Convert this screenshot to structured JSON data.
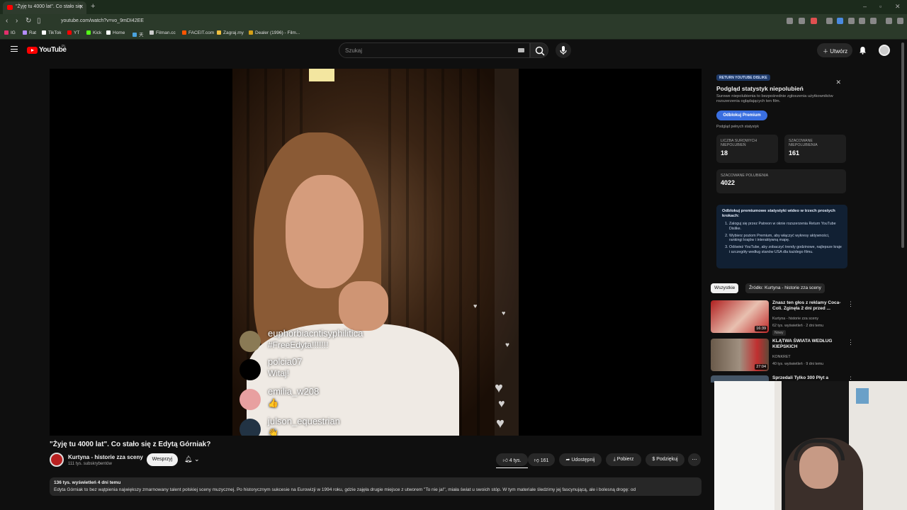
{
  "browser": {
    "tab_title": "\"Żyję tu 4000 lat\". Co stało się",
    "url": "youtube.com/watch?v=vo_9mDI42EE",
    "bookmarks": [
      {
        "label": "IG",
        "color": "#e1306c"
      },
      {
        "label": "Rat",
        "color": "#b48cff"
      },
      {
        "label": "TikTok",
        "color": "#ffffff"
      },
      {
        "label": "YT",
        "color": "#ff0000"
      },
      {
        "label": "Kick",
        "color": "#53fc18"
      },
      {
        "label": "Home",
        "color": "#ffffff"
      },
      {
        "label": "天",
        "color": "#4aa3df"
      },
      {
        "label": "Filman.cc",
        "color": "#cccccc"
      },
      {
        "label": "FACEIT.com",
        "color": "#ff5500"
      },
      {
        "label": "Zagraj.my",
        "color": "#f0c040"
      },
      {
        "label": "Dealer (1996) - Film...",
        "color": "#d4a017"
      }
    ]
  },
  "header": {
    "logo_text": "YouTube",
    "logo_region": "PL",
    "search_placeholder": "Szukaj",
    "create_label": "Utwórz"
  },
  "video": {
    "chat": [
      {
        "name": "euphorbiacntisyphilitica",
        "message": "#FreeEdyta!!!!!!!",
        "avatar_color": "#8a7a55"
      },
      {
        "name": "polcia07",
        "message": "Witaj!",
        "avatar_color": "#000000"
      },
      {
        "name": "emilia_w208",
        "message": "👍",
        "avatar_color": "#e8a0a0"
      },
      {
        "name": "julson_equestrian",
        "message": "👋",
        "avatar_color": "#223344"
      }
    ],
    "title": "\"Żyję tu 4000 lat\". Co stało się z Edytą Górniak?",
    "channel_name": "Kurtyna - historie zza sceny",
    "channel_subs": "111 tys. subskrybentów",
    "support_label": "Wesprzyj",
    "likes": "4 tys.",
    "dislikes": "161",
    "share_label": "Udostępnij",
    "download_label": "Pobierz",
    "thanks_label": "Podziękuj",
    "description_stats": "136 tys. wyświetleń  4 dni temu",
    "description_text": "Edyta Górniak to bez wątpienia największy zmarnowany talent polskiej sceny muzycznej. Po historycznym sukcesie na Eurowizji w 1994 roku, gdzie zajęła drugie miejsce z utworem \"To nie ja!\", miała świat u swoich stóp. W tym materiale śledzimy jej fascynującą, ale i bolesną drogę: od"
  },
  "dislike_panel": {
    "tag": "RETURN YOUTUBE DISLIKE",
    "title": "Podgląd statystyk niepolubień",
    "subtitle": "Surowe niepolubienia to bezpośrednie zgłoszenia użytkowników rozszerzenia oglądających ten film.",
    "unlock_label": "Odblokuj Premium",
    "full_stats_link": "Podgląd pełnych statystyk",
    "stats": [
      {
        "label": "LICZBA SUROWYCH NIEPOLUBIEŃ",
        "value": "18"
      },
      {
        "label": "SZACOWANE NIEPOLUBIENIA",
        "value": "161"
      },
      {
        "label": "SZACOWANE POLUBIENIA",
        "value": "4022"
      }
    ],
    "info_heading": "Odblokuj premiumowe statystyki wideo w trzech prostych krokach:",
    "info_steps": [
      "Zaloguj się przez Patreon w oknie rozszerzenia Return YouTube Dislike.",
      "Wybierz poziom Premium, aby włączyć wykresy aktywności, rankingi krajów i interaktywną mapę.",
      "Odśwież YouTube, aby zobaczyć trendy godzinowe, najlepsze kraje i szczegóły według stanów USA dla każdego filmu."
    ]
  },
  "chips": [
    "Wszystkie",
    "Źródło: Kurtyna - historie zza sceny"
  ],
  "recommended": [
    {
      "title": "Znasz ten głos z reklamy Coca-Coli. Zginęła 2 dni przed ...",
      "channel": "Kurtyna - historie zza sceny",
      "meta": "62 tys. wyświetleń · 2 dni temu",
      "badge": "Nowy",
      "duration": "16:39",
      "color": "#c8302a"
    },
    {
      "title": "KLĄTWA ŚWIATA WEDŁUG KIEPSKICH",
      "channel": "KONKRET",
      "meta": "40 tys. wyświetleń · 9 dni temu",
      "badge": "",
      "duration": "27:04",
      "color": "#7a6a5a"
    },
    {
      "title": "Sprzedali Tylko 300 Płyt a",
      "channel": "",
      "meta": "",
      "badge": "",
      "duration": "",
      "color": "#445566"
    }
  ]
}
